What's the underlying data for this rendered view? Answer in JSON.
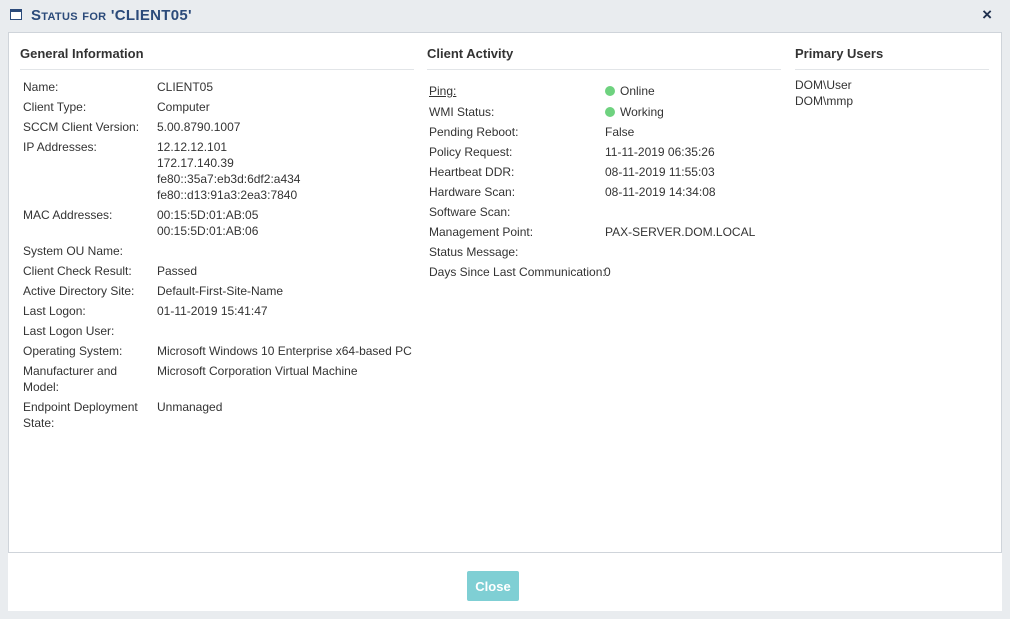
{
  "dialog": {
    "title": "Status for 'CLIENT05'",
    "close_icon": "×"
  },
  "general": {
    "heading": "General Information",
    "rows": [
      {
        "label": "Name:",
        "value": [
          "CLIENT05"
        ]
      },
      {
        "label": "Client Type:",
        "value": [
          "Computer"
        ]
      },
      {
        "label": "SCCM Client Version:",
        "value": [
          "5.00.8790.1007"
        ]
      },
      {
        "label": "IP Addresses:",
        "value": [
          "12.12.12.101",
          "172.17.140.39",
          "fe80::35a7:eb3d:6df2:a434",
          "fe80::d13:91a3:2ea3:7840"
        ]
      },
      {
        "label": "MAC Addresses:",
        "value": [
          "00:15:5D:01:AB:05",
          "00:15:5D:01:AB:06"
        ]
      },
      {
        "label": "System OU Name:",
        "value": []
      },
      {
        "label": "Client Check Result:",
        "value": [
          "Passed"
        ]
      },
      {
        "label": "Active Directory Site:",
        "value": [
          "Default-First-Site-Name"
        ]
      },
      {
        "label": "Last Logon:",
        "value": [
          "01-11-2019 15:41:47"
        ]
      },
      {
        "label": "Last Logon User:",
        "value": []
      },
      {
        "label": "Operating System:",
        "value": [
          "Microsoft Windows 10 Enterprise x64-based PC"
        ]
      },
      {
        "label": "Manufacturer and Model:",
        "value": [
          "Microsoft Corporation Virtual Machine"
        ]
      },
      {
        "label": "Endpoint Deployment State:",
        "value": [
          "Unmanaged"
        ]
      }
    ]
  },
  "activity": {
    "heading": "Client Activity",
    "rows": [
      {
        "label": "Ping:",
        "value": "Online",
        "status": "green"
      },
      {
        "label": "WMI Status:",
        "value": "Working",
        "status": "green"
      },
      {
        "label": "Pending Reboot:",
        "value": "False"
      },
      {
        "label": "Policy Request:",
        "value": "11-11-2019 06:35:26"
      },
      {
        "label": "Heartbeat DDR:",
        "value": "08-11-2019 11:55:03"
      },
      {
        "label": "Hardware Scan:",
        "value": "08-11-2019 14:34:08"
      },
      {
        "label": "Software Scan:",
        "value": ""
      },
      {
        "label": "Management Point:",
        "value": "PAX-SERVER.DOM.LOCAL"
      },
      {
        "label": "Status Message:",
        "value": ""
      },
      {
        "label": "Days Since Last Communication:",
        "value": "0"
      }
    ]
  },
  "users": {
    "heading": "Primary Users",
    "items": [
      "DOM\\User",
      "DOM\\mmp"
    ]
  },
  "footer": {
    "close_label": "Close"
  },
  "colors": {
    "title": "#2b4a7a",
    "status_green": "#6ed27f",
    "close_button": "#7fcfd4"
  }
}
